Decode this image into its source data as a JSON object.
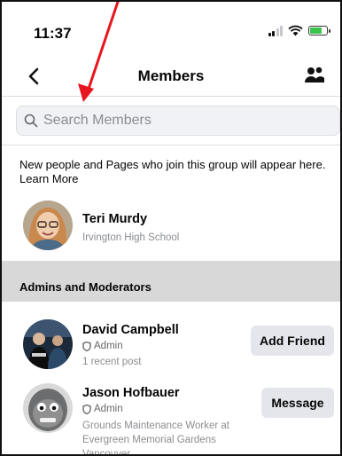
{
  "status_bar": {
    "time": "11:37"
  },
  "nav": {
    "title": "Members",
    "back_icon": "chevron-left-icon",
    "action_icon": "people-icon"
  },
  "search": {
    "placeholder": "Search Members",
    "value": ""
  },
  "info": {
    "text": "New people and Pages who join this group will appear here.",
    "link": "Learn More"
  },
  "new_member": {
    "name": "Teri Murdy",
    "subtitle": "Irvington High School"
  },
  "admins_section": {
    "title": "Admins and Moderators",
    "members": [
      {
        "name": "David Campbell",
        "role": "Admin",
        "detail_lines": [
          "1 recent post"
        ],
        "action": "Add Friend"
      },
      {
        "name": "Jason Hofbauer",
        "role": "Admin",
        "detail_lines": [
          "Grounds Maintenance Worker at",
          "Evergreen Memorial Gardens",
          "Vancouver"
        ],
        "action": "Message"
      }
    ]
  },
  "colors": {
    "annotation_arrow": "#e8141e",
    "section_bg": "#d8d8d8",
    "button_bg": "#e4e6eb",
    "battery": "#3ac34a"
  }
}
